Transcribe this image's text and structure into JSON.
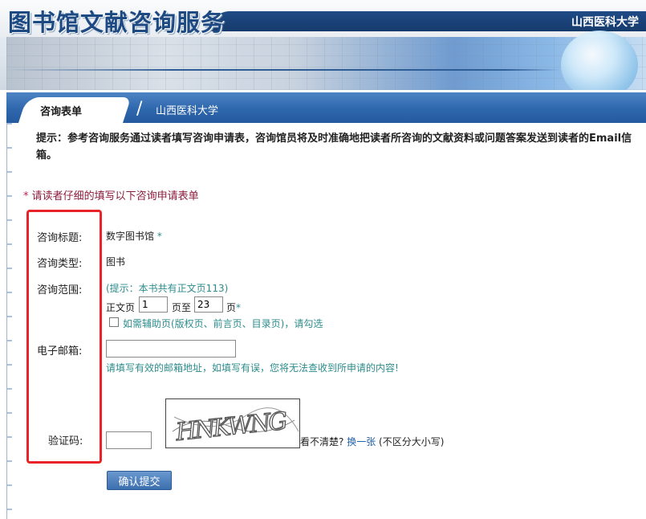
{
  "header": {
    "logo_title": "图书馆文献咨询服务",
    "university": "山西医科大学"
  },
  "nav": {
    "active_tab": "咨询表单",
    "separator": "/",
    "university": "山西医科大学"
  },
  "tip": "提示：参考咨询服务通过读者填写咨询申请表，咨询馆员将及时准确地把读者所咨询的文献资料或问题答案发送到读者的Email信箱。",
  "notice": {
    "star": "*",
    "text": "请读者仔细的填写以下咨询申请表单"
  },
  "form": {
    "title_label": "咨询标题:",
    "title_value": "数字图书馆",
    "required_star": "*",
    "type_label": "咨询类型:",
    "type_value": "图书",
    "range_label": "咨询范围:",
    "range_hint": "(提示：本书共有正文页113)",
    "page_prefix": "正文页",
    "page_from": "1",
    "page_to_label": "页至",
    "page_to": "23",
    "page_suffix": "页",
    "aux_pages_label": "如需辅助页(版权页、前言页、目录页)，请勾选",
    "email_label": "电子邮箱:",
    "email_value": "",
    "email_hint": "请填写有效的邮箱地址，如填写有误，您将无法查收到所申请的内容!",
    "captcha_label": "验证码:",
    "captcha_value": "",
    "captcha_text": "HNKWNG",
    "unclear": "看不清楚?",
    "refresh_link": "换一张",
    "case_hint": "(不区分大小写)",
    "submit": "确认提交"
  },
  "colors": {
    "primary_blue": "#1f4b86",
    "nav_blue": "#2f67ad",
    "notice_red": "#8c1d3c",
    "hint_teal": "#2d8c8c",
    "annotation_red": "#e8232a"
  }
}
